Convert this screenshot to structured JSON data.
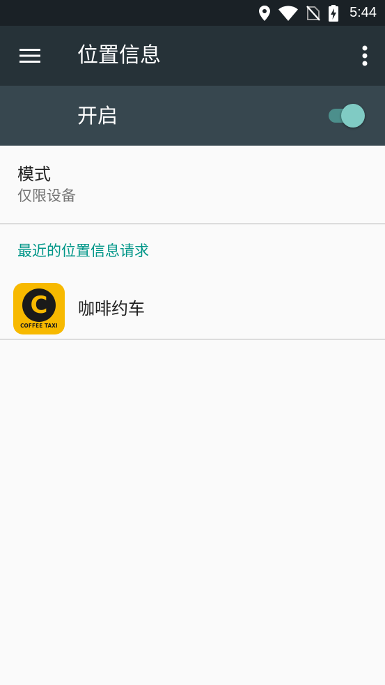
{
  "status_bar": {
    "time": "5:44",
    "icons": [
      "location-icon",
      "wifi-icon",
      "no-sim-icon",
      "battery-charging-icon"
    ]
  },
  "app_bar": {
    "title": "位置信息",
    "navigation_icon": "menu-icon",
    "action_icon": "more-vert-icon"
  },
  "master_switch": {
    "label": "开启",
    "checked": true
  },
  "mode": {
    "title": "模式",
    "summary": "仅限设备"
  },
  "recent_requests": {
    "header": "最近的位置信息请求",
    "apps": [
      {
        "name": "咖啡约车",
        "icon_letter": "C",
        "icon_caption": "COFFEE TAXI"
      }
    ]
  },
  "colors": {
    "status_bar": "#1a2126",
    "app_bar": "#263238",
    "switch_bar": "#37474f",
    "accent": "#009688",
    "toggle_thumb": "#80cbc4",
    "app_icon_bg": "#f7b900",
    "background": "#fafafa"
  }
}
